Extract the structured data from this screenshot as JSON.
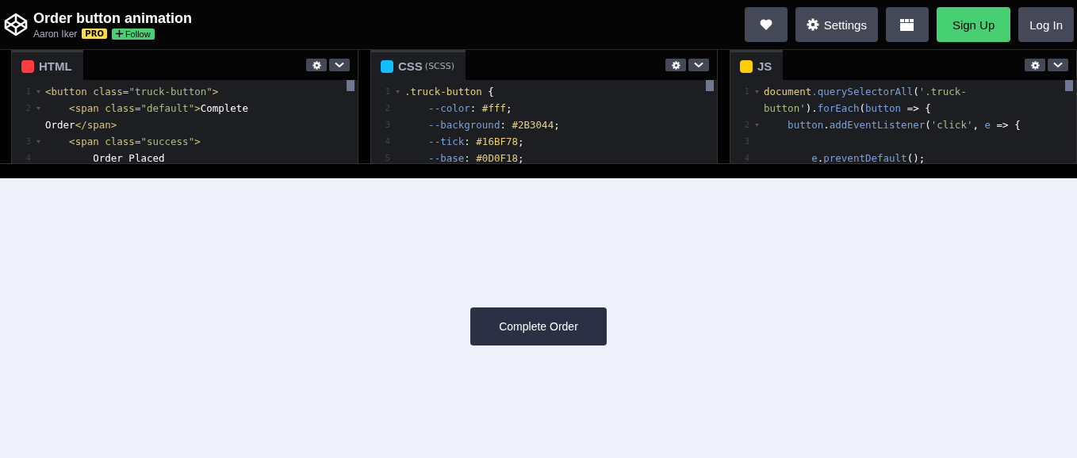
{
  "header": {
    "title": "Order button animation",
    "author": "Aaron Iker",
    "badge": "PRO",
    "follow": "Follow",
    "buttons": [
      {
        "kind": "heart"
      },
      {
        "kind": "settings",
        "label": "Settings"
      },
      {
        "kind": "layout"
      },
      {
        "kind": "signup",
        "label": "Sign Up"
      },
      {
        "kind": "login",
        "label": "Log In"
      }
    ]
  },
  "editors": [
    {
      "kind": "html",
      "name": "HTML",
      "lines": [
        {
          "number": "1",
          "foldable": true,
          "rows": [
            {
              "tokens": [
                {
                  "text": "<button ",
                  "kind": "tag"
                },
                {
                  "text": "class",
                  "kind": "attr"
                },
                {
                  "text": "=",
                  "kind": "plain"
                },
                {
                  "text": "\"truck-button\"",
                  "kind": "string"
                },
                {
                  "text": ">",
                  "kind": "tag"
                }
              ]
            }
          ]
        },
        {
          "number": "2",
          "foldable": true,
          "rows": [
            {
              "tokens": [
                {
                  "text": "    <span ",
                  "kind": "tag"
                },
                {
                  "text": "class",
                  "kind": "attr"
                },
                {
                  "text": "=",
                  "kind": "plain"
                },
                {
                  "text": "\"default\"",
                  "kind": "string"
                },
                {
                  "text": ">",
                  "kind": "tag"
                },
                {
                  "text": "Complete",
                  "kind": "text"
                }
              ]
            },
            {
              "tokens": [
                {
                  "text": "Order",
                  "kind": "text"
                },
                {
                  "text": "</span>",
                  "kind": "tag"
                }
              ]
            }
          ]
        },
        {
          "number": "3",
          "foldable": true,
          "rows": [
            {
              "tokens": [
                {
                  "text": "    <span ",
                  "kind": "tag"
                },
                {
                  "text": "class",
                  "kind": "attr"
                },
                {
                  "text": "=",
                  "kind": "plain"
                },
                {
                  "text": "\"success\"",
                  "kind": "string"
                },
                {
                  "text": ">",
                  "kind": "tag"
                }
              ]
            }
          ]
        },
        {
          "number": "4",
          "foldable": false,
          "rows": [
            {
              "tokens": [
                {
                  "text": "        Order Placed",
                  "kind": "text"
                }
              ]
            }
          ]
        }
      ]
    },
    {
      "kind": "css",
      "name": "CSS",
      "sub": "(SCSS)",
      "lines": [
        {
          "number": "1",
          "foldable": true,
          "rows": [
            {
              "tokens": [
                {
                  "text": ".truck-button ",
                  "kind": "selector"
                },
                {
                  "text": "{",
                  "kind": "text"
                }
              ]
            }
          ]
        },
        {
          "number": "2",
          "foldable": false,
          "rows": [
            {
              "tokens": [
                {
                  "text": "    --color",
                  "kind": "prop"
                },
                {
                  "text": ": ",
                  "kind": "text"
                },
                {
                  "text": "#fff",
                  "kind": "value"
                },
                {
                  "text": ";",
                  "kind": "text"
                }
              ]
            }
          ]
        },
        {
          "number": "3",
          "foldable": false,
          "rows": [
            {
              "tokens": [
                {
                  "text": "    --background",
                  "kind": "prop"
                },
                {
                  "text": ": ",
                  "kind": "text"
                },
                {
                  "text": "#2B3044",
                  "kind": "value"
                },
                {
                  "text": ";",
                  "kind": "text"
                }
              ]
            }
          ]
        },
        {
          "number": "4",
          "foldable": false,
          "rows": [
            {
              "tokens": [
                {
                  "text": "    --tick",
                  "kind": "prop"
                },
                {
                  "text": ": ",
                  "kind": "text"
                },
                {
                  "text": "#16BF78",
                  "kind": "value"
                },
                {
                  "text": ";",
                  "kind": "text"
                }
              ]
            }
          ]
        },
        {
          "number": "5",
          "foldable": false,
          "rows": [
            {
              "tokens": [
                {
                  "text": "    --base",
                  "kind": "prop"
                },
                {
                  "text": ": ",
                  "kind": "text"
                },
                {
                  "text": "#0D0F18",
                  "kind": "value"
                },
                {
                  "text": ";",
                  "kind": "text"
                }
              ]
            }
          ]
        }
      ]
    },
    {
      "kind": "js",
      "name": "JS",
      "lines": [
        {
          "number": "1",
          "foldable": true,
          "rows": [
            {
              "tokens": [
                {
                  "text": "document",
                  "kind": "selector"
                },
                {
                  "text": ".querySelectorAll",
                  "kind": "prop"
                },
                {
                  "text": "(",
                  "kind": "text"
                },
                {
                  "text": "'.truck-",
                  "kind": "string"
                }
              ]
            },
            {
              "tokens": [
                {
                  "text": "button'",
                  "kind": "string"
                },
                {
                  "text": ").",
                  "kind": "text"
                },
                {
                  "text": "forEach",
                  "kind": "prop"
                },
                {
                  "text": "(",
                  "kind": "text"
                },
                {
                  "text": "button",
                  "kind": "prop"
                },
                {
                  "text": " => {",
                  "kind": "text"
                }
              ]
            }
          ]
        },
        {
          "number": "2",
          "foldable": true,
          "rows": [
            {
              "tokens": [
                {
                  "text": "    button",
                  "kind": "prop"
                },
                {
                  "text": ".",
                  "kind": "text"
                },
                {
                  "text": "addEventListener",
                  "kind": "prop"
                },
                {
                  "text": "(",
                  "kind": "text"
                },
                {
                  "text": "'click'",
                  "kind": "string"
                },
                {
                  "text": ", ",
                  "kind": "text"
                },
                {
                  "text": "e",
                  "kind": "prop"
                },
                {
                  "text": " => {",
                  "kind": "text"
                }
              ]
            }
          ]
        },
        {
          "number": "3",
          "foldable": false
        },
        {
          "number": "4",
          "foldable": false,
          "rows": [
            {
              "tokens": [
                {
                  "text": "        e",
                  "kind": "prop"
                },
                {
                  "text": ".",
                  "kind": "text"
                },
                {
                  "text": "preventDefault",
                  "kind": "prop"
                },
                {
                  "text": "();",
                  "kind": "text"
                }
              ]
            }
          ]
        }
      ]
    }
  ],
  "preview": {
    "button": "Complete Order"
  }
}
